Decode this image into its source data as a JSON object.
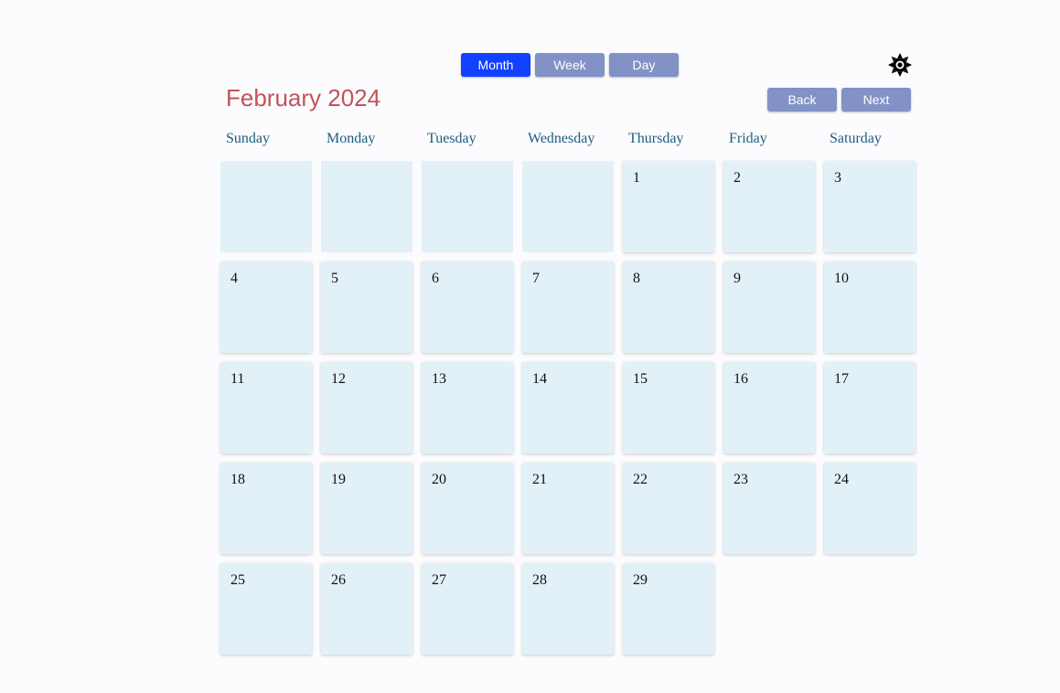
{
  "views": [
    {
      "label": "Month",
      "active": true
    },
    {
      "label": "Week",
      "active": false
    },
    {
      "label": "Day",
      "active": false
    }
  ],
  "theme_toggle_icon": "sun-icon",
  "title": "February 2024",
  "nav": {
    "back_label": "Back",
    "next_label": "Next"
  },
  "weekdays": [
    "Sunday",
    "Monday",
    "Tuesday",
    "Wednesday",
    "Thursday",
    "Friday",
    "Saturday"
  ],
  "leading_blank_days": 4,
  "days": [
    "1",
    "2",
    "3",
    "4",
    "5",
    "6",
    "7",
    "8",
    "9",
    "10",
    "11",
    "12",
    "13",
    "14",
    "15",
    "16",
    "17",
    "18",
    "19",
    "20",
    "21",
    "22",
    "23",
    "24",
    "25",
    "26",
    "27",
    "28",
    "29"
  ],
  "colors": {
    "active_view": "#1240ff",
    "button": "#8292c6",
    "title": "#c1535b",
    "weekday_text": "#1b5e7f",
    "cell_background": "#e2f1f7"
  }
}
